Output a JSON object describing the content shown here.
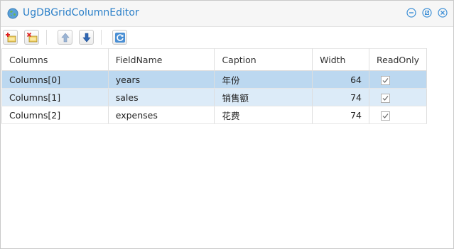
{
  "window": {
    "title": "UgDBGridColumnEditor",
    "icon": "globe-icon",
    "controls": [
      "minimize-icon",
      "restore-icon",
      "close-icon"
    ]
  },
  "toolbar": {
    "buttons": [
      {
        "name": "add-column-button",
        "icon": "add-icon"
      },
      {
        "name": "delete-column-button",
        "icon": "delete-icon"
      },
      {
        "name": "move-up-button",
        "icon": "arrow-up-icon"
      },
      {
        "name": "move-down-button",
        "icon": "arrow-down-icon"
      },
      {
        "name": "refresh-button",
        "icon": "refresh-icon"
      }
    ]
  },
  "grid": {
    "headers": {
      "columns": "Columns",
      "fieldname": "FieldName",
      "caption": "Caption",
      "width": "Width",
      "readonly": "ReadOnly"
    },
    "rows": [
      {
        "column": "Columns[0]",
        "fieldname": "years",
        "caption": "年份",
        "width": "64",
        "readonly": true
      },
      {
        "column": "Columns[1]",
        "fieldname": "sales",
        "caption": "销售额",
        "width": "74",
        "readonly": true
      },
      {
        "column": "Columns[2]",
        "fieldname": "expenses",
        "caption": "花费",
        "width": "74",
        "readonly": true
      }
    ]
  },
  "colors": {
    "title": "#2a7fc8",
    "selected_row": "#bcd8f0",
    "hover_row": "#dcebf8"
  }
}
